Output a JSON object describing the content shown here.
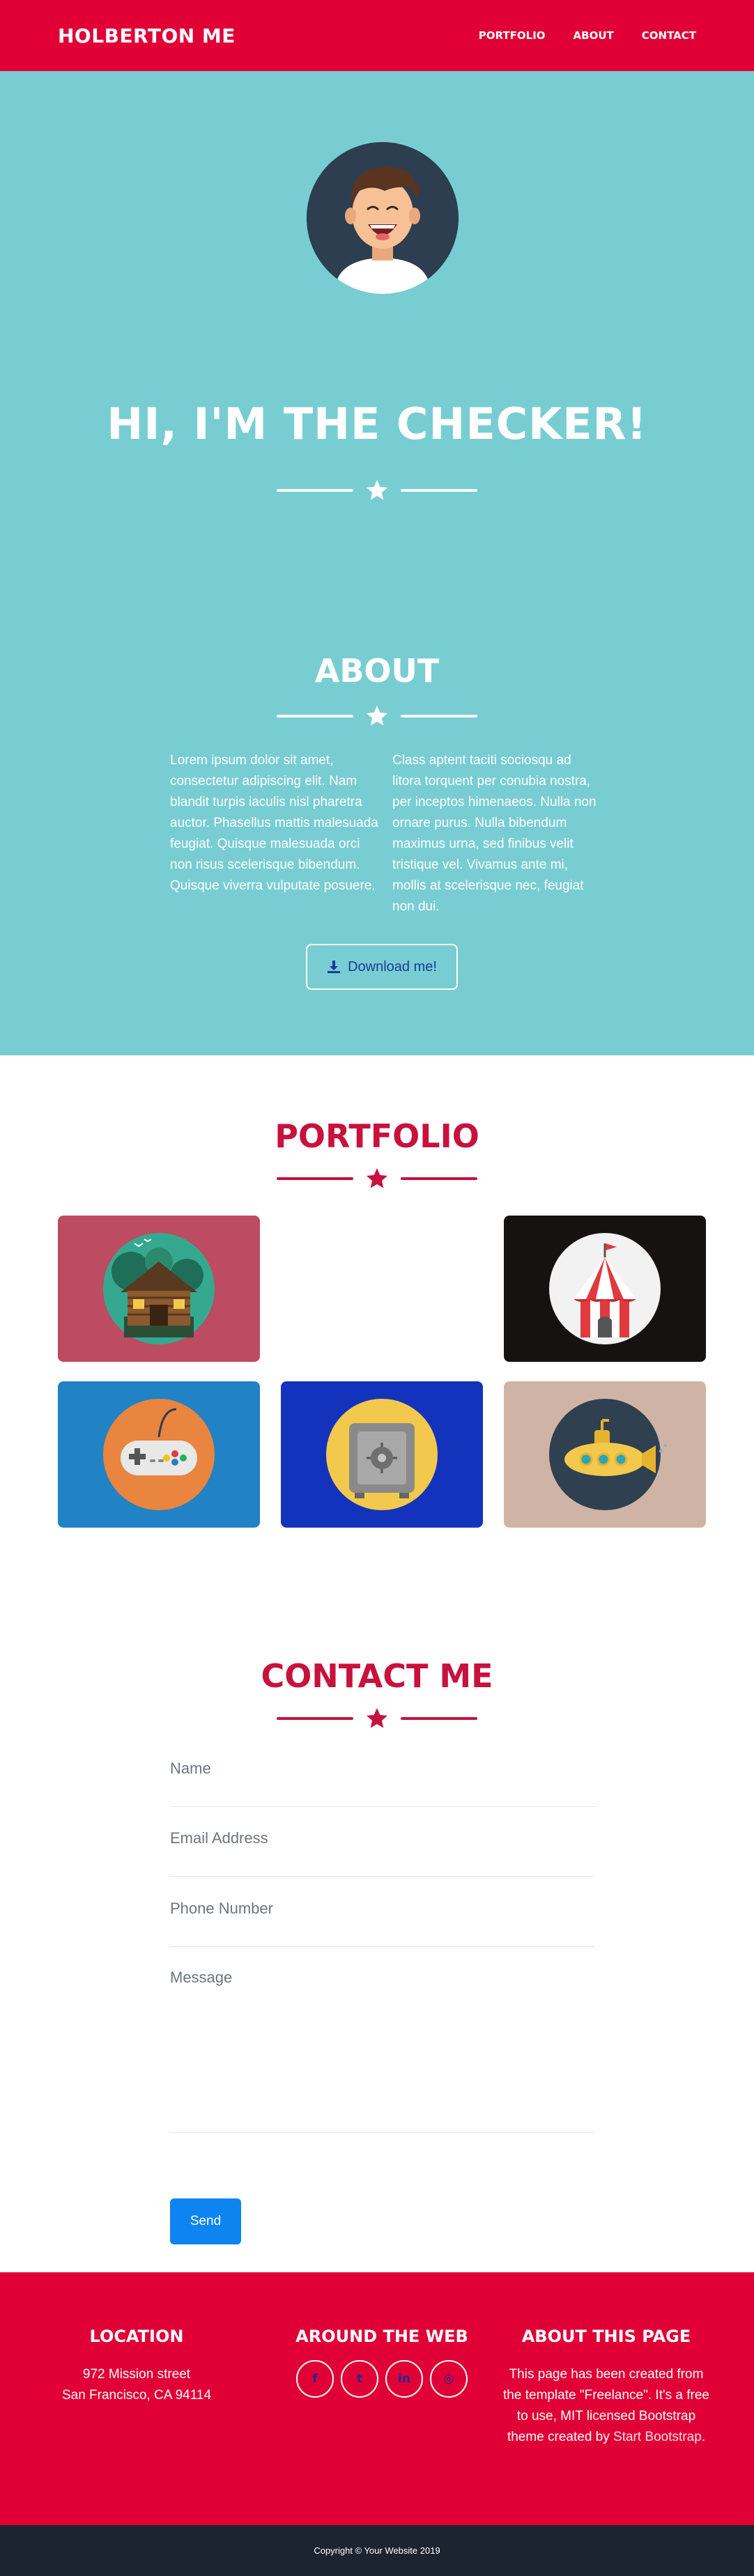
{
  "colors": {
    "brand": "#e10036",
    "teal": "#78cdd2",
    "accent": "#c8113c",
    "button": "#0d84f0",
    "dark": "#1c2331"
  },
  "navbar": {
    "brand": "HOLBERTON ME",
    "links": [
      "PORTFOLIO",
      "ABOUT",
      "CONTACT"
    ]
  },
  "masthead": {
    "avatar_icon": "avatar-icon",
    "heading": "HI, I'M THE CHECKER!",
    "divider_icon": "star-icon"
  },
  "about": {
    "heading": "ABOUT",
    "left_text": "Lorem ipsum dolor sit amet, consectetur adipiscing elit. Nam blandit turpis iaculis nisl pharetra auctor. Phasellus mattis malesuada feugiat. Quisque malesuada orci non risus scelerisque bibendum. Quisque viverra vulputate posuere.",
    "right_text": "Class aptent taciti sociosqu ad litora torquent per conubia nostra, per inceptos himenaeos. Nulla non ornare purus. Nulla bibendum maximus urna, sed finibus velit tristique vel. Vivamus ante mi, mollis at scelerisque nec, feugiat non dui.",
    "download_label": "Download me!",
    "download_icon": "download-icon"
  },
  "portfolio": {
    "heading": "PORTFOLIO",
    "items": [
      {
        "icon": "cabin-icon",
        "bg": "#bd4b61"
      },
      {
        "icon": "circus-tent-icon",
        "bg": "#161212"
      },
      {
        "icon": "game-controller-icon",
        "bg": "#2182c5"
      },
      {
        "icon": "safe-icon",
        "bg": "#1433bd"
      },
      {
        "icon": "submarine-icon",
        "bg": "#cfb4a5"
      }
    ]
  },
  "contact": {
    "heading": "CONTACT ME",
    "name_placeholder": "Name",
    "email_placeholder": "Email Address",
    "phone_placeholder": "Phone Number",
    "message_placeholder": "Message",
    "send_label": "Send"
  },
  "footer": {
    "location_heading": "LOCATION",
    "location_line1": "972 Mission street",
    "location_line2": "San Francisco, CA 94114",
    "web_heading": "AROUND THE WEB",
    "social": [
      {
        "icon": "facebook-icon",
        "glyph": "f"
      },
      {
        "icon": "twitter-icon",
        "glyph": "t"
      },
      {
        "icon": "linkedin-icon",
        "glyph": "in"
      },
      {
        "icon": "dribbble-icon",
        "glyph": "◎"
      }
    ],
    "about_heading": "ABOUT THIS PAGE",
    "about_text": "This page has been created from the template \"Freelance\". It's a free to use, MIT licensed Bootstrap theme created by",
    "about_link": "Start Bootstrap",
    "about_end": "."
  },
  "copyright": "Copyright © Your Website 2019"
}
